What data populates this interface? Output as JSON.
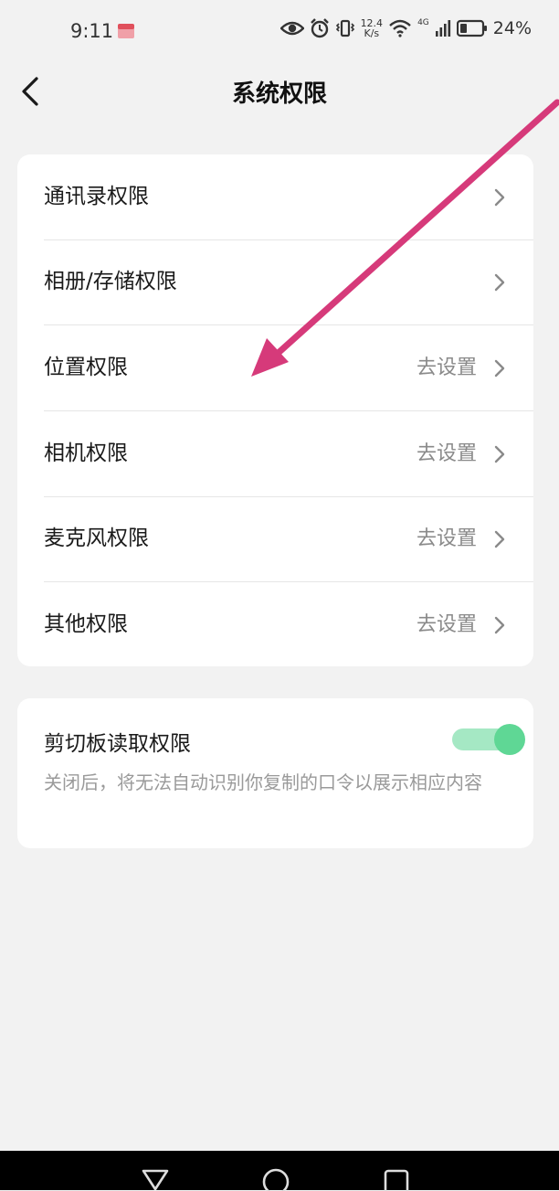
{
  "status_bar": {
    "time": "9:11",
    "network_speed_value": "12.4",
    "network_speed_unit": "K/s",
    "network_type": "4G",
    "battery_percent": "24%",
    "icons": [
      "eye-icon",
      "alarm-icon",
      "vibrate-icon",
      "wifi-icon",
      "signal-icon",
      "battery-icon"
    ]
  },
  "header": {
    "title": "系统权限"
  },
  "permissions": [
    {
      "label": "通讯录权限",
      "action": ""
    },
    {
      "label": "相册/存储权限",
      "action": ""
    },
    {
      "label": "位置权限",
      "action": "去设置"
    },
    {
      "label": "相机权限",
      "action": "去设置"
    },
    {
      "label": "麦克风权限",
      "action": "去设置"
    },
    {
      "label": "其他权限",
      "action": "去设置"
    }
  ],
  "clipboard": {
    "title": "剪切板读取权限",
    "description": "关闭后，将无法自动识别你复制的口令以展示相应内容",
    "enabled": true
  },
  "colors": {
    "background": "#f2f2f2",
    "toggle_on": "#5fd795",
    "annotation_arrow": "#d63a7a"
  },
  "nav_bar": {
    "buttons": [
      "back-triangle-icon",
      "home-circle-icon",
      "recents-square-icon"
    ]
  }
}
